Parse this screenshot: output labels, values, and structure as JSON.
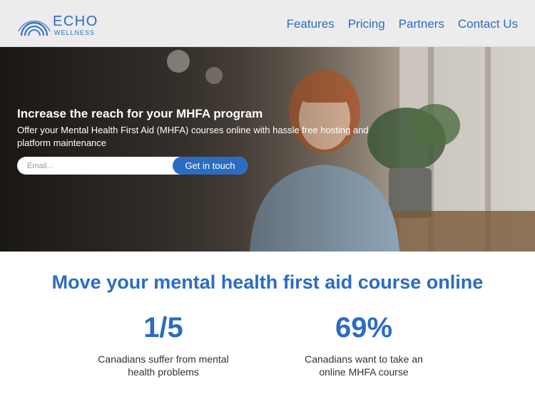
{
  "brand": {
    "name": "ECHO",
    "tagline": "WELLNESS",
    "color": "#2b6cc4"
  },
  "nav": {
    "items": [
      "Features",
      "Pricing",
      "Partners",
      "Contact Us"
    ]
  },
  "hero": {
    "title": "Increase the reach for your MHFA program",
    "subtitle": "Offer your Mental Health First Aid (MHFA) courses online with hassle free hosting and platform maintenance",
    "email_placeholder": "Email...",
    "cta_label": "Get in touch"
  },
  "stats_section": {
    "title": "Move your mental health first aid course online",
    "stats": [
      {
        "value": "1/5",
        "text": "Canadians suffer from mental health problems"
      },
      {
        "value": "69%",
        "text": "Canadians want to take an online MHFA course"
      }
    ]
  }
}
